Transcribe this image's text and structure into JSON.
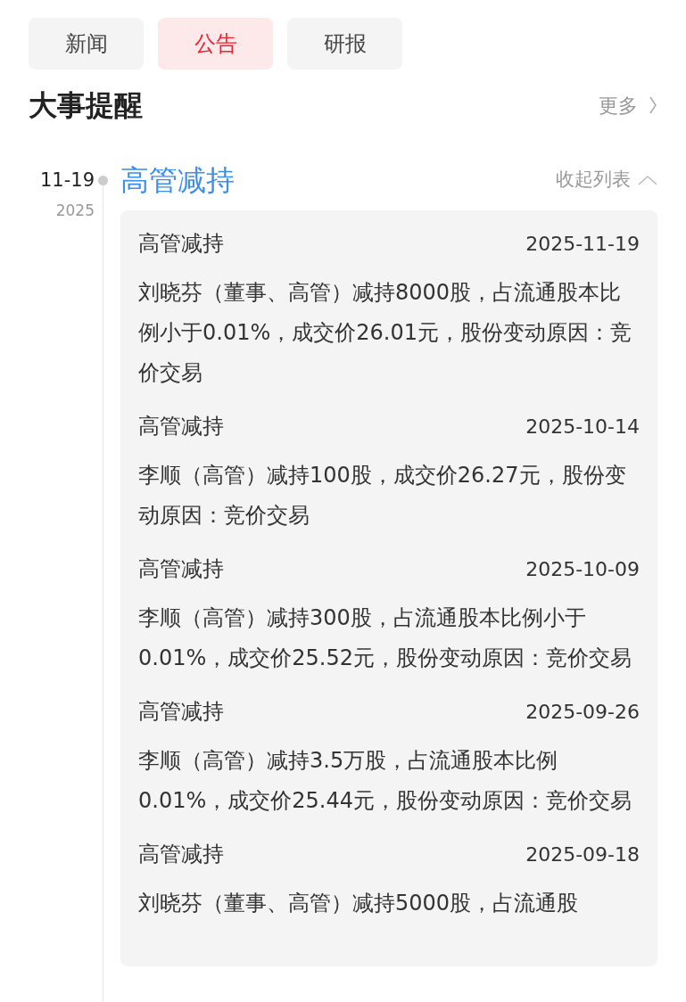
{
  "tabs": [
    {
      "label": "新闻",
      "selected": false
    },
    {
      "label": "公告",
      "selected": true
    },
    {
      "label": "研报",
      "selected": false
    }
  ],
  "section": {
    "title": "大事提醒",
    "more": "更多"
  },
  "timeline": [
    {
      "date": "11-19",
      "year": "2025",
      "title": "高管减持",
      "toggle": "收起列表",
      "expanded": true,
      "items": [
        {
          "title": "高管减持",
          "date": "2025-11-19",
          "text": "刘晓芬（董事、高管）减持8000股，占流通股本比例小于0.01%，成交价26.01元，股份变动原因：竞价交易"
        },
        {
          "title": "高管减持",
          "date": "2025-10-14",
          "text": "李顺（高管）减持100股，成交价26.27元，股份变动原因：竞价交易"
        },
        {
          "title": "高管减持",
          "date": "2025-10-09",
          "text": "李顺（高管）减持300股，占流通股本比例小于0.01%，成交价25.52元，股份变动原因：竞价交易"
        },
        {
          "title": "高管减持",
          "date": "2025-09-26",
          "text": "李顺（高管）减持3.5万股，占流通股本比例0.01%，成交价25.44元，股份变动原因：竞价交易"
        },
        {
          "title": "高管减持",
          "date": "2025-09-18",
          "text": "刘晓芬（董事、高管）减持5000股，占流通股"
        }
      ]
    }
  ]
}
